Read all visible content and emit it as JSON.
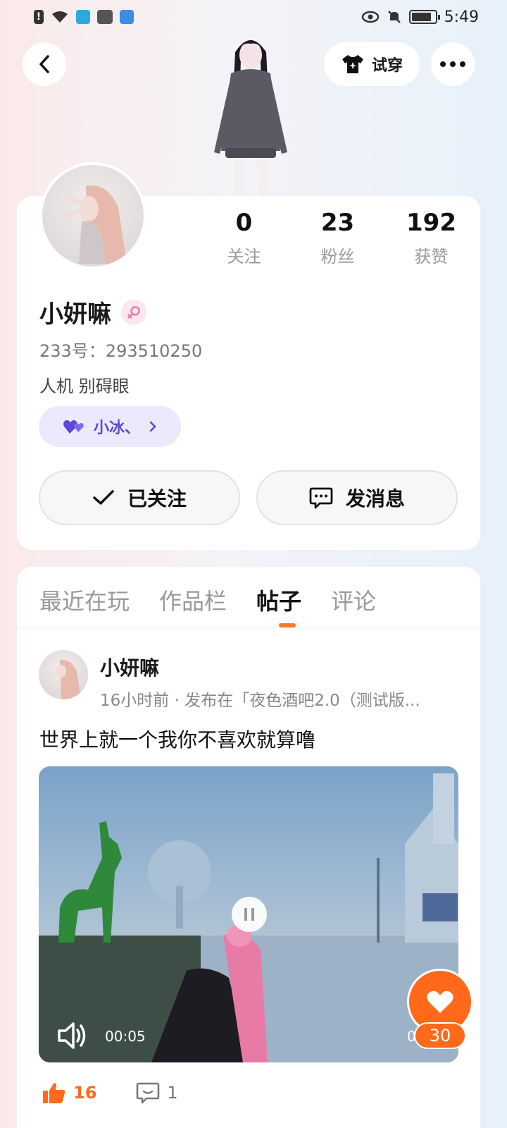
{
  "status_bar": {
    "time": "5:49"
  },
  "header": {
    "tryon_label": "试穿"
  },
  "profile": {
    "stats": [
      {
        "value": "0",
        "label": "关注"
      },
      {
        "value": "23",
        "label": "粉丝"
      },
      {
        "value": "192",
        "label": "获赞"
      }
    ],
    "name": "小妍嘛",
    "uid": "233号：293510250",
    "bio": "人机 别碍眼",
    "cp_tag": "小冰、",
    "follow_label": "已关注",
    "message_label": "发消息"
  },
  "tabs": [
    {
      "label": "最近在玩"
    },
    {
      "label": "作品栏"
    },
    {
      "label": "帖子"
    },
    {
      "label": "评论"
    }
  ],
  "post": {
    "author": "小妍嘛",
    "meta": "16小时前 · 发布在「夜色酒吧2.0（测试版...",
    "text": "世界上就一个我你不喜欢就算噜",
    "video_time": "00:05",
    "video_time_right": "0",
    "fab_like_count": "30",
    "like_count": "16",
    "comment_count": "1"
  },
  "colors": {
    "accent": "#ff6a1a",
    "cp_tag_text": "#5a48d6",
    "cp_tag_bg": "#ece9fc"
  }
}
